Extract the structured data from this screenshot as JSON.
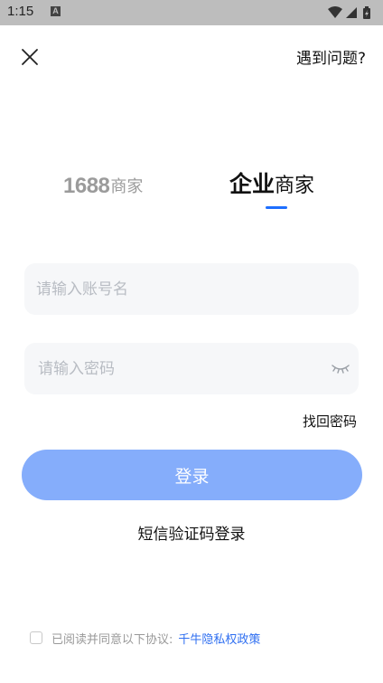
{
  "status_bar": {
    "time": "1:15",
    "notification_letter": "A",
    "icons": [
      "wifi-icon",
      "signal-icon",
      "battery-icon"
    ]
  },
  "header": {
    "help_label": "遇到问题?"
  },
  "tabs": [
    {
      "strong": "1688",
      "suffix": "商家",
      "active": false
    },
    {
      "strong": "企业",
      "suffix": "商家",
      "active": true
    }
  ],
  "form": {
    "account_placeholder": "请输入账号名",
    "account_value": "",
    "password_placeholder": "请输入密码",
    "password_value": "",
    "forgot_label": "找回密码",
    "login_label": "登录",
    "sms_login_label": "短信验证码登录"
  },
  "agreement": {
    "checked": false,
    "text": "已阅读并同意以下协议:",
    "policy_link": "千牛隐私权政策"
  },
  "colors": {
    "accent": "#1e6fff",
    "login_button": "#85adfb",
    "link": "#2f6ff1",
    "input_bg": "#f6f7f9"
  }
}
